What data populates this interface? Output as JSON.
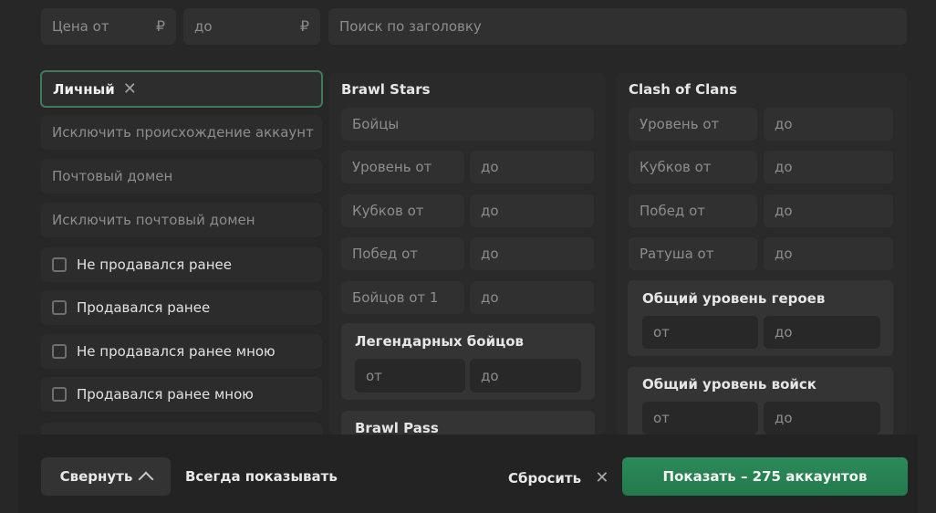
{
  "top": {
    "price_from": "Цена от",
    "price_to": "до",
    "currency": "₽",
    "search_placeholder": "Поиск по заголовку"
  },
  "left": {
    "chip_label": "Личный",
    "exclude_origin": "Исключить происхождение аккаунт",
    "mail_domain": "Почтовый домен",
    "exclude_mail_domain": "Исключить почтовый домен",
    "checkboxes": [
      "Не продавался ранее",
      "Продавался ранее",
      "Не продавался ранее мною",
      "Продавался ранее мною"
    ]
  },
  "brawl": {
    "title": "Brawl Stars",
    "fighters": "Бойцы",
    "level_from": "Уровень от",
    "cups_from": "Кубков от",
    "wins_from": "Побед от",
    "fighters_from": "Бойцов от 1",
    "to": "до",
    "legendary_title": "Легендарных бойцов",
    "from": "от",
    "pass_title": "Brawl Pass"
  },
  "coc": {
    "title": "Clash of Clans",
    "level_from": "Уровень от",
    "cups_from": "Кубков от",
    "wins_from": "Побед от",
    "townhall_from": "Ратуша от",
    "to": "до",
    "heroes_title": "Общий уровень героев",
    "troops_title": "Общий уровень войск",
    "from": "от"
  },
  "footer": {
    "collapse": "Свернуть",
    "always_show": "Всегда показывать",
    "reset": "Сбросить",
    "show": "Показать – 275 аккаунтов"
  },
  "colors": {
    "accent": "#2b8a59",
    "chip_border": "#3e7b5e"
  }
}
